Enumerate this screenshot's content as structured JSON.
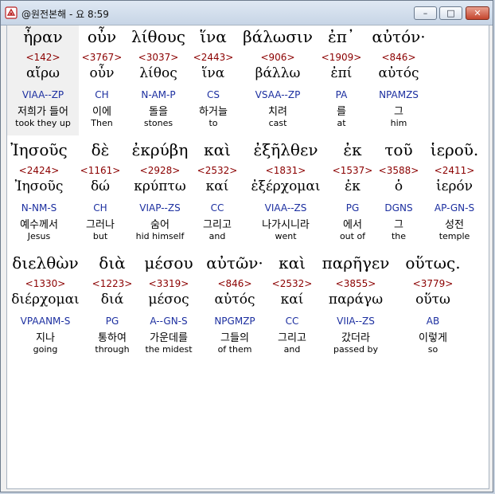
{
  "window": {
    "title": "@원전본해 - 요 8:59",
    "icon": "app-icon",
    "minimize": "–",
    "maximize": "□",
    "close": "✕"
  },
  "verse": {
    "lines": [
      {
        "words": [
          {
            "greek": "ἦραν",
            "strong": "<142>",
            "lemma": "αἴρω",
            "parse": "VIAA--ZP",
            "korean": "저희가 들어",
            "english": "took they up",
            "selected": true
          },
          {
            "greek": "οὖν",
            "strong": "<3767>",
            "lemma": "οὖν",
            "parse": "CH",
            "korean": "이에",
            "english": "Then"
          },
          {
            "greek": "λίθους",
            "strong": "<3037>",
            "lemma": "λίθος",
            "parse": "N-AM-P",
            "korean": "돌을",
            "english": "stones"
          },
          {
            "greek": "ἵνα",
            "strong": "<2443>",
            "lemma": "ἵνα",
            "parse": "CS",
            "korean": "하거늘",
            "english": "to"
          },
          {
            "greek": "βάλωσιν",
            "strong": "<906>",
            "lemma": "βάλλω",
            "parse": "VSAA--ZP",
            "korean": "치려",
            "english": "cast"
          },
          {
            "greek": "ἐπ᾽",
            "strong": "<1909>",
            "lemma": "ἐπί",
            "parse": "PA",
            "korean": "를",
            "english": "at"
          },
          {
            "greek": "αὐτόν·",
            "strong": "<846>",
            "lemma": "αὐτός",
            "parse": "NPAMZS",
            "korean": "그",
            "english": "him"
          }
        ]
      },
      {
        "words": [
          {
            "greek": "Ἰησοῦς",
            "strong": "<2424>",
            "lemma": "Ἰησοῦς",
            "parse": "N-NM-S",
            "korean": "예수께서",
            "english": "Jesus"
          },
          {
            "greek": "δὲ",
            "strong": "<1161>",
            "lemma": "δώ",
            "parse": "CH",
            "korean": "그러나",
            "english": "but"
          },
          {
            "greek": "ἐκρύβη",
            "strong": "<2928>",
            "lemma": "κρύπτω",
            "parse": "VIAP--ZS",
            "korean": "숨어",
            "english": "hid himself"
          },
          {
            "greek": "καὶ",
            "strong": "<2532>",
            "lemma": "καί",
            "parse": "CC",
            "korean": "그리고",
            "english": "and"
          },
          {
            "greek": "ἐξῆλθεν",
            "strong": "<1831>",
            "lemma": "ἐξέρχομαι",
            "parse": "VIAA--ZS",
            "korean": "나가시니라",
            "english": "went"
          },
          {
            "greek": "ἐκ",
            "strong": "<1537>",
            "lemma": "ἐκ",
            "parse": "PG",
            "korean": "에서",
            "english": "out of"
          },
          {
            "greek": "τοῦ",
            "strong": "<3588>",
            "lemma": "ὁ",
            "parse": "DGNS",
            "korean": "그",
            "english": "the"
          },
          {
            "greek": "ἱεροῦ.",
            "strong": "<2411>",
            "lemma": "ἱερόν",
            "parse": "AP-GN-S",
            "korean": "성전",
            "english": "temple"
          }
        ]
      },
      {
        "words": [
          {
            "greek": "διελθὼν",
            "strong": "<1330>",
            "lemma": "διέρχομαι",
            "parse": "VPAANM-S",
            "korean": "지나",
            "english": "going"
          },
          {
            "greek": "διὰ",
            "strong": "<1223>",
            "lemma": "διά",
            "parse": "PG",
            "korean": "통하여",
            "english": "through"
          },
          {
            "greek": "μέσου",
            "strong": "<3319>",
            "lemma": "μέσος",
            "parse": "A--GN-S",
            "korean": "가운데를",
            "english": "the midest"
          },
          {
            "greek": "αὐτῶν·",
            "strong": "<846>",
            "lemma": "αὐτός",
            "parse": "NPGMZP",
            "korean": "그들의",
            "english": "of them"
          },
          {
            "greek": "καὶ",
            "strong": "<2532>",
            "lemma": "καί",
            "parse": "CC",
            "korean": "그리고",
            "english": "and"
          },
          {
            "greek": "παρῆγεν",
            "strong": "<3855>",
            "lemma": "παράγω",
            "parse": "VIIA--ZS",
            "korean": "갔더라",
            "english": "passed by"
          },
          {
            "greek": "οὕτως.",
            "strong": "<3779>",
            "lemma": "οὕτω",
            "parse": "AB",
            "korean": "이렇게",
            "english": "so"
          }
        ]
      }
    ]
  }
}
